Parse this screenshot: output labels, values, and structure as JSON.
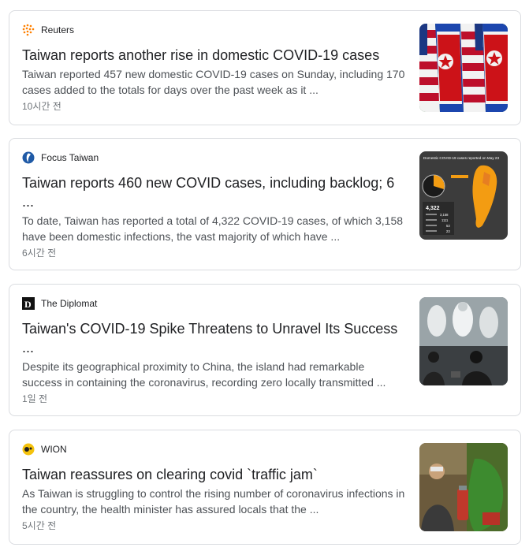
{
  "articles": [
    {
      "source": "Reuters",
      "source_icon": "reuters-logo-icon",
      "headline": "Taiwan reports another rise in domestic COVID-19 cases",
      "snippet": "Taiwan reported 457 new domestic COVID-19 cases on Sunday, including 170 cases added to the totals for days over the past week as it ...",
      "time": "10시간 전",
      "thumbnail": "flags-image"
    },
    {
      "source": "Focus Taiwan",
      "source_icon": "focus-taiwan-logo-icon",
      "headline": "Taiwan reports 460 new COVID cases, including backlog; 6 ...",
      "snippet": "To date, Taiwan has reported a total of 4,322 COVID-19 cases, of which 3,158 have been domestic infections, the vast majority of which have ...",
      "time": "6시간 전",
      "thumbnail": "taiwan-map-infographic-image",
      "thumb_text": {
        "title": "Domestic COVID-19 cases reported on May 23",
        "total": "4,322",
        "rows": [
          "3,158",
          "1111",
          "53",
          "23"
        ]
      }
    },
    {
      "source": "The Diplomat",
      "source_icon": "the-diplomat-logo-icon",
      "headline": "Taiwan's COVID-19 Spike Threatens to Unravel Its Success ...",
      "snippet": "Despite its geographical proximity to China, the island had remarkable success in containing the coronavirus, recording zero locally transmitted ...",
      "time": "1일 전",
      "thumbnail": "press-briefing-image"
    },
    {
      "source": "WION",
      "source_icon": "wion-logo-icon",
      "headline": "Taiwan reassures on clearing covid `traffic jam`",
      "snippet": "As Taiwan is struggling to control the rising number of coronavirus infections in the country, the health minister has assured locals that the ...",
      "time": "5시간 전",
      "thumbnail": "disinfection-worker-image"
    }
  ],
  "colors": {
    "reuters": "#ff8000",
    "focus_taiwan": "#1f5aa6",
    "wion": "#f4c20d",
    "headline": "#202124",
    "snippet": "#4d5156",
    "time": "#70757a"
  }
}
